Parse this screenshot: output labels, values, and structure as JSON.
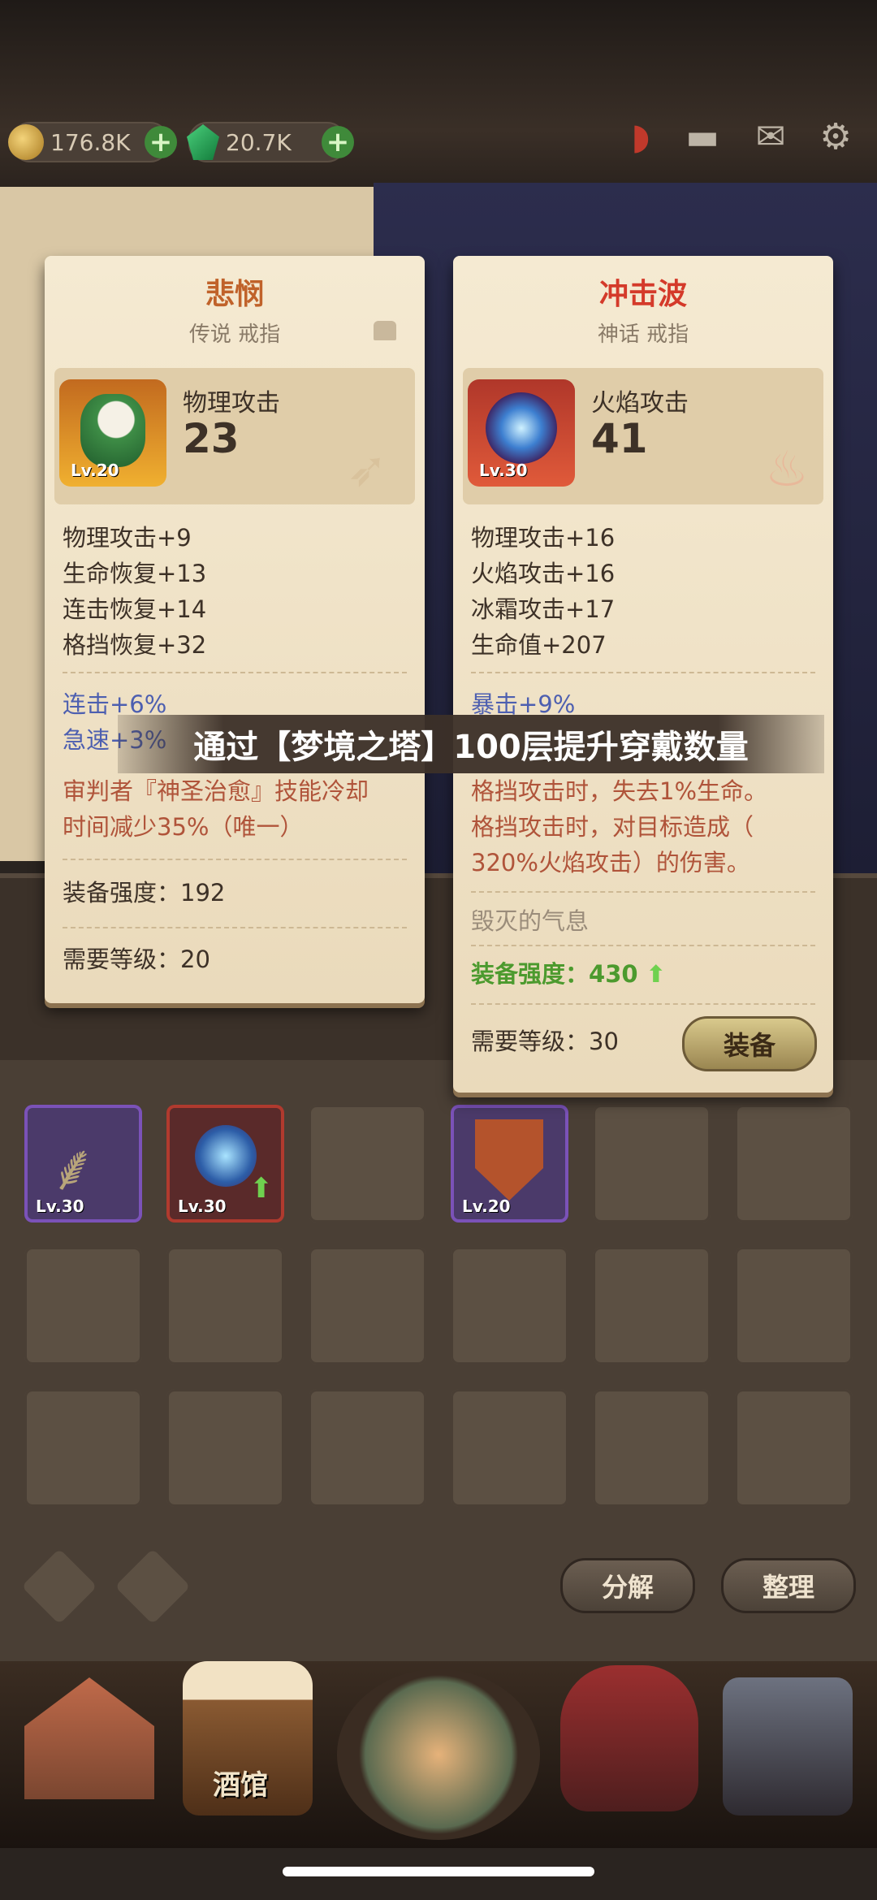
{
  "resources": {
    "gold": "176.8K",
    "gems": "20.7K"
  },
  "banner": "通过【梦境之塔】100层提升穿戴数量",
  "card_left": {
    "name": "悲悯",
    "rarity": "传说 戒指",
    "main_attr": "物理攻击",
    "main_value": "23",
    "level_badge": "Lv.20",
    "stats": [
      "物理攻击+9",
      "生命恢复+13",
      "连击恢复+14",
      "格挡恢复+32"
    ],
    "special": [
      "连击+6%",
      "急速+3%"
    ],
    "skill_lines": [
      "审判者『神圣治愈』技能冷却",
      "时间减少35%（唯一）"
    ],
    "strength": "装备强度：192",
    "required_level": "需要等级：20"
  },
  "card_right": {
    "name": "冲击波",
    "rarity": "神话 戒指",
    "main_attr": "火焰攻击",
    "main_value": "41",
    "level_badge": "Lv.30",
    "stats": [
      "物理攻击+16",
      "火焰攻击+16",
      "冰霜攻击+17",
      "生命值+207"
    ],
    "special": [
      "暴击+9%"
    ],
    "effects": [
      "格挡攻击时，失去1%生命。",
      "格挡攻击时，对目标造成（",
      "320%火焰攻击）的伤害。"
    ],
    "set_name": "毁灭的气息",
    "strength_label": "装备强度：",
    "strength_value": "430",
    "required_level": "需要等级：30",
    "equip_button": "装备"
  },
  "inventory": {
    "items": [
      {
        "level": "Lv.30",
        "icon": "dagger-icon"
      },
      {
        "level": "Lv.30",
        "icon": "ring-icon"
      },
      {
        "level": "",
        "icon": ""
      },
      {
        "level": "Lv.20",
        "icon": "shield-icon"
      }
    ],
    "decompose_button": "分解",
    "sort_button": "整理"
  },
  "nav": {
    "tavern_label": "酒馆"
  },
  "colors": {
    "legend_title": "#c0622a",
    "myth_title": "#d43a2a",
    "purple_frame": "#6a3fa0"
  }
}
